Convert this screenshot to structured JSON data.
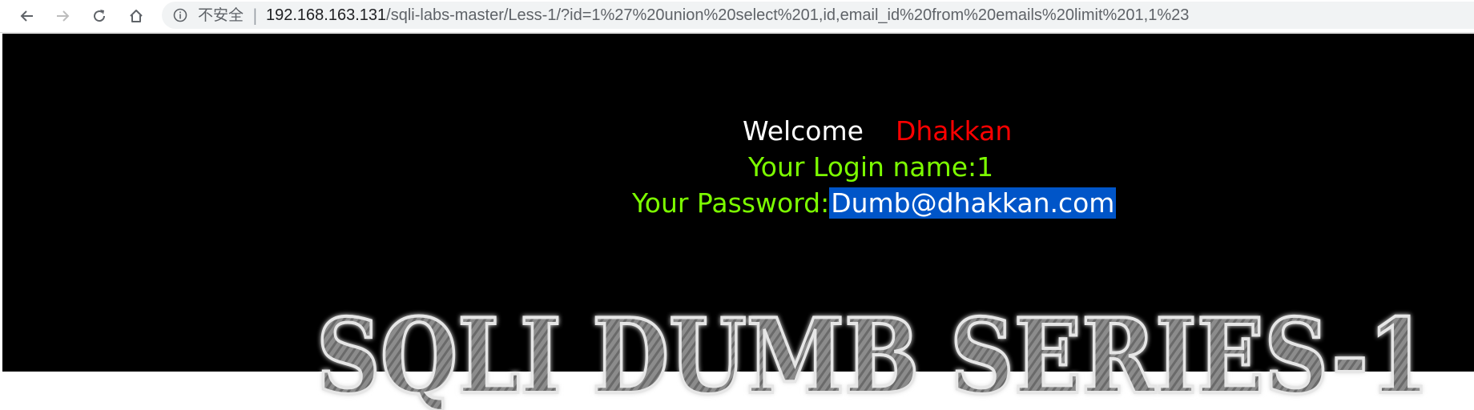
{
  "browser": {
    "security_label": "不安全",
    "separator": "|",
    "url_host": "192.168.163.131",
    "url_path": "/sqli-labs-master/Less-1/?id=1%27%20union%20select%201,id,email_id%20from%20emails%20limit%201,1%23"
  },
  "page": {
    "welcome_word": "Welcome",
    "welcome_name": "Dhakkan",
    "login_label": "Your Login name:",
    "login_value": "1",
    "password_label": "Your Password:",
    "password_value": "Dumb@dhakkan.com",
    "banner_text": "SQLI DUMB SERIES-1"
  },
  "colors": {
    "page_background": "#000000",
    "welcome_text": "#ffffff",
    "name_text": "#ff0000",
    "info_text": "#7cfc00",
    "selection_highlight": "#0055c8"
  }
}
